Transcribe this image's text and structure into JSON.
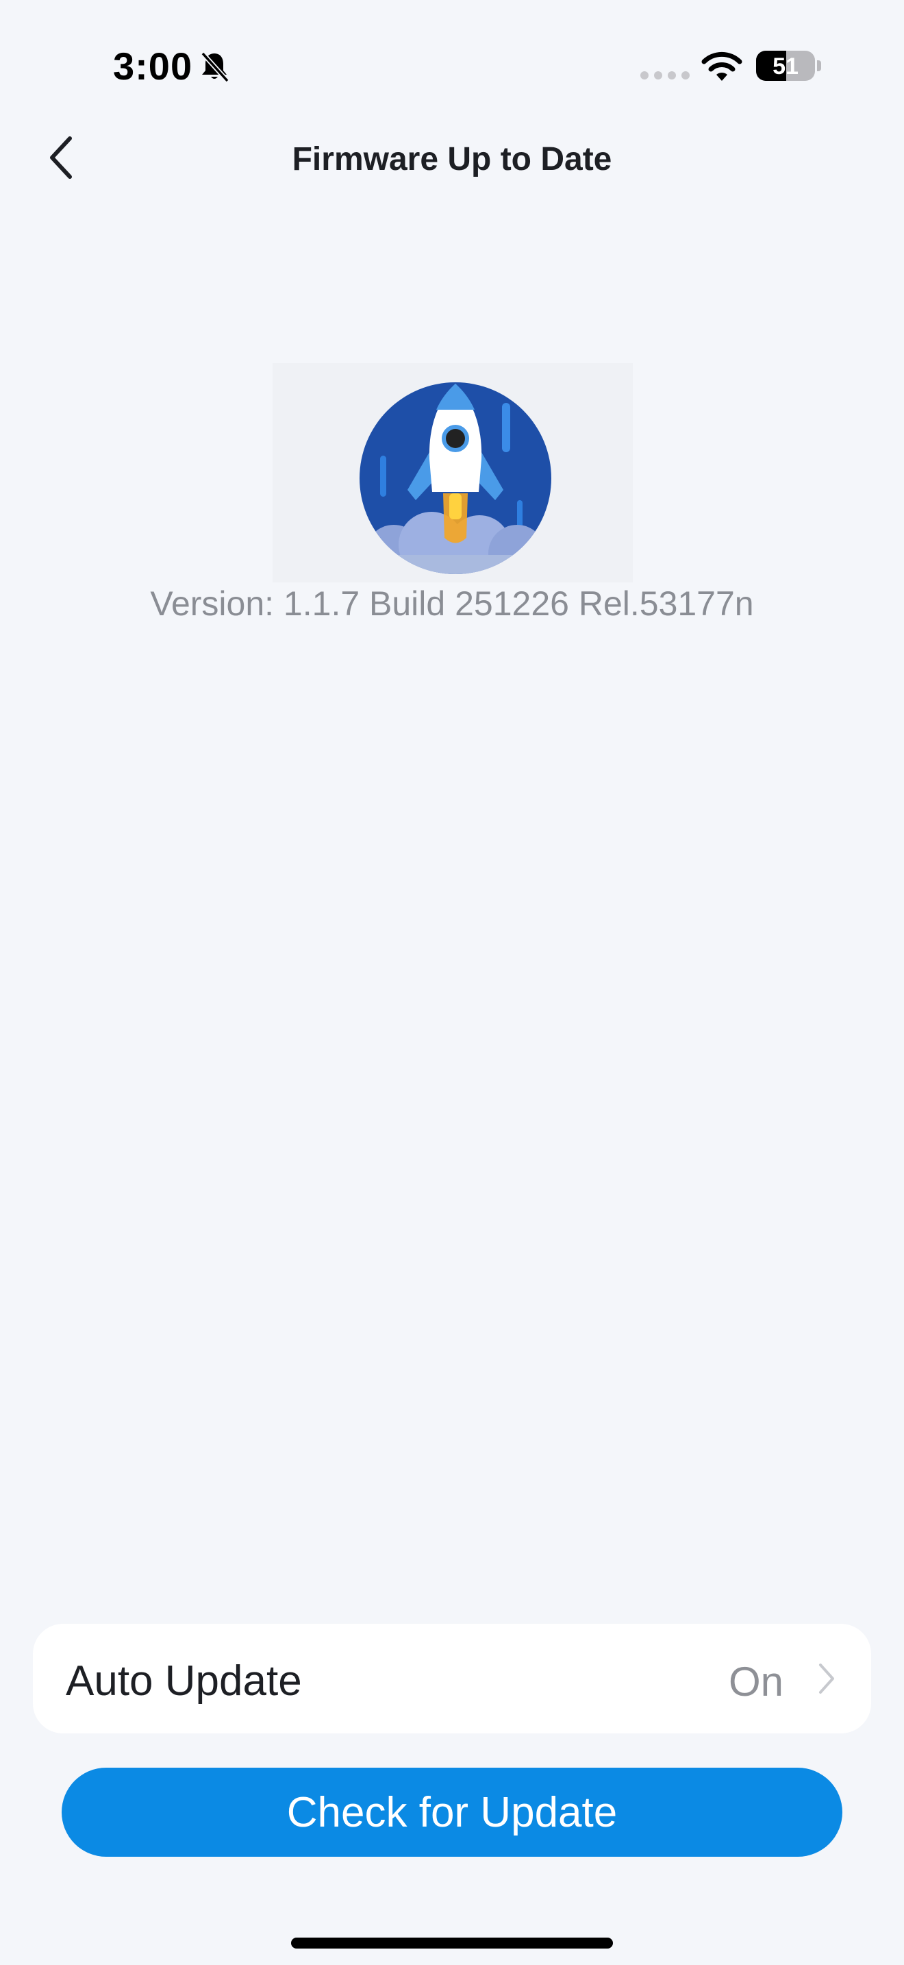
{
  "status_bar": {
    "time": "3:00",
    "bell_icon": "bell-slash-icon",
    "wifi_icon": "wifi-icon",
    "battery_percent": "51",
    "battery_level": 0.51
  },
  "nav": {
    "back_icon": "chevron-left-icon",
    "title": "Firmware Up to Date"
  },
  "hero": {
    "icon": "rocket-launch-icon",
    "version_text": "Version: 1.1.7 Build 251226 Rel.53177n"
  },
  "auto_update": {
    "label": "Auto Update",
    "value": "On",
    "chevron_icon": "chevron-right-icon"
  },
  "actions": {
    "check_button_label": "Check for Update"
  },
  "colors": {
    "background": "#f4f6fa",
    "primary_button": "#0b8ae4",
    "rocket_circle": "#1e4fa8"
  }
}
